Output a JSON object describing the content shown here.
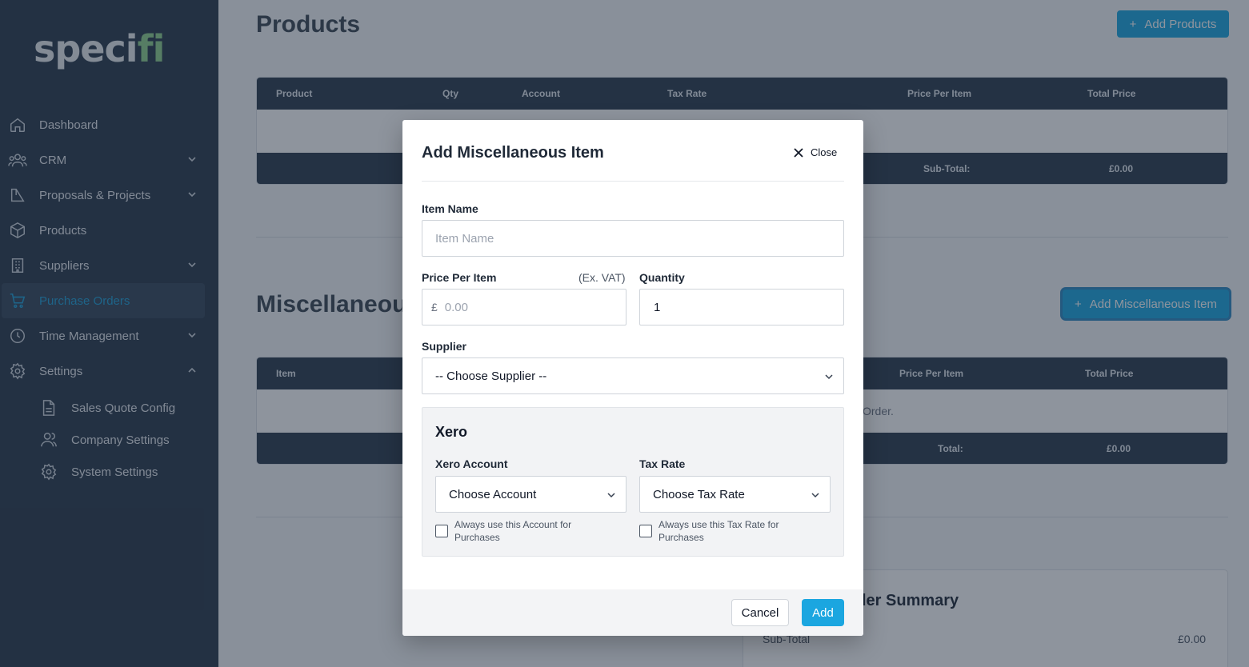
{
  "brand": {
    "logo_text_a": "spec",
    "logo_text_b": "fi",
    "logo_dot": "i"
  },
  "sidebar": {
    "items": [
      {
        "label": "Dashboard",
        "icon": "home-icon",
        "expandable": false
      },
      {
        "label": "CRM",
        "icon": "users-icon",
        "expandable": true
      },
      {
        "label": "Proposals & Projects",
        "icon": "chart-icon",
        "expandable": true
      },
      {
        "label": "Products",
        "icon": "cube-icon",
        "expandable": false
      },
      {
        "label": "Suppliers",
        "icon": "building-icon",
        "expandable": true
      },
      {
        "label": "Purchase Orders",
        "icon": "cart-icon",
        "expandable": false,
        "active": true
      },
      {
        "label": "Time Management",
        "icon": "clock-icon",
        "expandable": true
      },
      {
        "label": "Settings",
        "icon": "gear-icon",
        "expandable": true,
        "expanded": true
      }
    ],
    "sub_items": [
      {
        "label": "Sales Quote Config",
        "icon": "document-icon"
      },
      {
        "label": "Company Settings",
        "icon": "users-icon"
      },
      {
        "label": "System Settings",
        "icon": "gear-icon"
      }
    ]
  },
  "products_section": {
    "title": "Products",
    "add_button": "Add Products",
    "columns": [
      "Product",
      "Qty",
      "Account",
      "Tax Rate",
      "Price Per Item",
      "Total Price"
    ],
    "subtotal_label": "Sub-Total:",
    "subtotal_value": "£0.00"
  },
  "misc_section": {
    "title": "Miscellaneous",
    "add_button": "Add Miscellaneous Item",
    "columns": [
      "Item",
      "Price Per Item",
      "Total Price"
    ],
    "empty_text": "Order.",
    "total_label": "Total:",
    "total_value": "£0.00"
  },
  "order_summary": {
    "title": "ler Summary",
    "subtotal_label": "Sub-Total",
    "subtotal_value": "£0.00"
  },
  "modal": {
    "title": "Add Miscellaneous Item",
    "close_label": "Close",
    "item_name": {
      "label": "Item Name",
      "placeholder": "Item Name",
      "value": ""
    },
    "price": {
      "label": "Price Per Item",
      "note": "(Ex. VAT)",
      "currency": "£",
      "placeholder": "0.00"
    },
    "quantity": {
      "label": "Quantity",
      "value": "1"
    },
    "supplier": {
      "label": "Supplier",
      "selected": "-- Choose Supplier --"
    },
    "xero": {
      "title": "Xero",
      "account": {
        "label": "Xero Account",
        "selected": "Choose Account",
        "checkbox": "Always use this Account for Purchases",
        "checked": false
      },
      "tax_rate": {
        "label": "Tax Rate",
        "selected": "Choose Tax Rate",
        "checkbox": "Always use this Tax Rate for Purchases",
        "checked": false
      }
    },
    "cancel_label": "Cancel",
    "add_label": "Add"
  },
  "colors": {
    "sidebar_bg": "#29384a",
    "accent": "#1ba6e0",
    "table_header": "#2b3a4c"
  }
}
